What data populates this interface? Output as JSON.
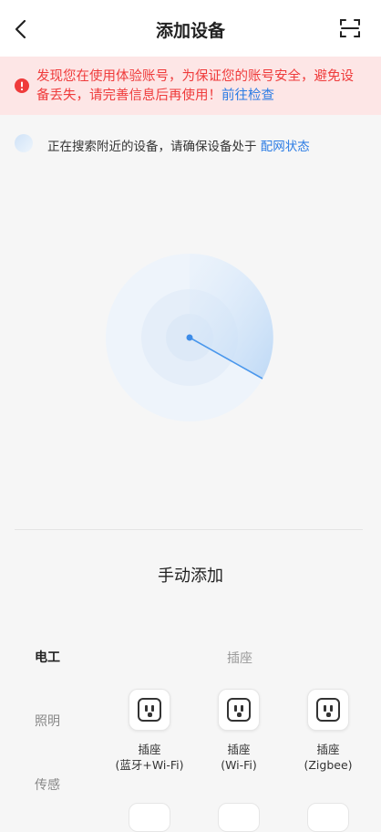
{
  "header": {
    "title": "添加设备",
    "back_icon": "chevron-left-icon",
    "scan_icon": "scan-icon"
  },
  "warning": {
    "text": "发现您在使用体验账号，为保证您的账号安全，避免设备丢失，请完善信息后再使用！",
    "link": "前往检查",
    "color": "#ef3b3b",
    "background": "#fde6e6"
  },
  "search_status": {
    "text": "正在搜索附近的设备，请确保设备处于",
    "link": "配网状态",
    "link_color": "#2a7be4"
  },
  "manual": {
    "title": "手动添加",
    "categories": [
      {
        "label": "电工",
        "active": true
      },
      {
        "label": "照明",
        "active": false
      },
      {
        "label": "传感",
        "active": false
      }
    ],
    "section_title": "插座",
    "devices": [
      {
        "label": "插座\n(蓝牙+Wi-Fi)",
        "icon": "socket-icon"
      },
      {
        "label": "插座\n(Wi-Fi)",
        "icon": "socket-icon"
      },
      {
        "label": "插座\n(Zigbee)",
        "icon": "socket-icon"
      }
    ]
  }
}
